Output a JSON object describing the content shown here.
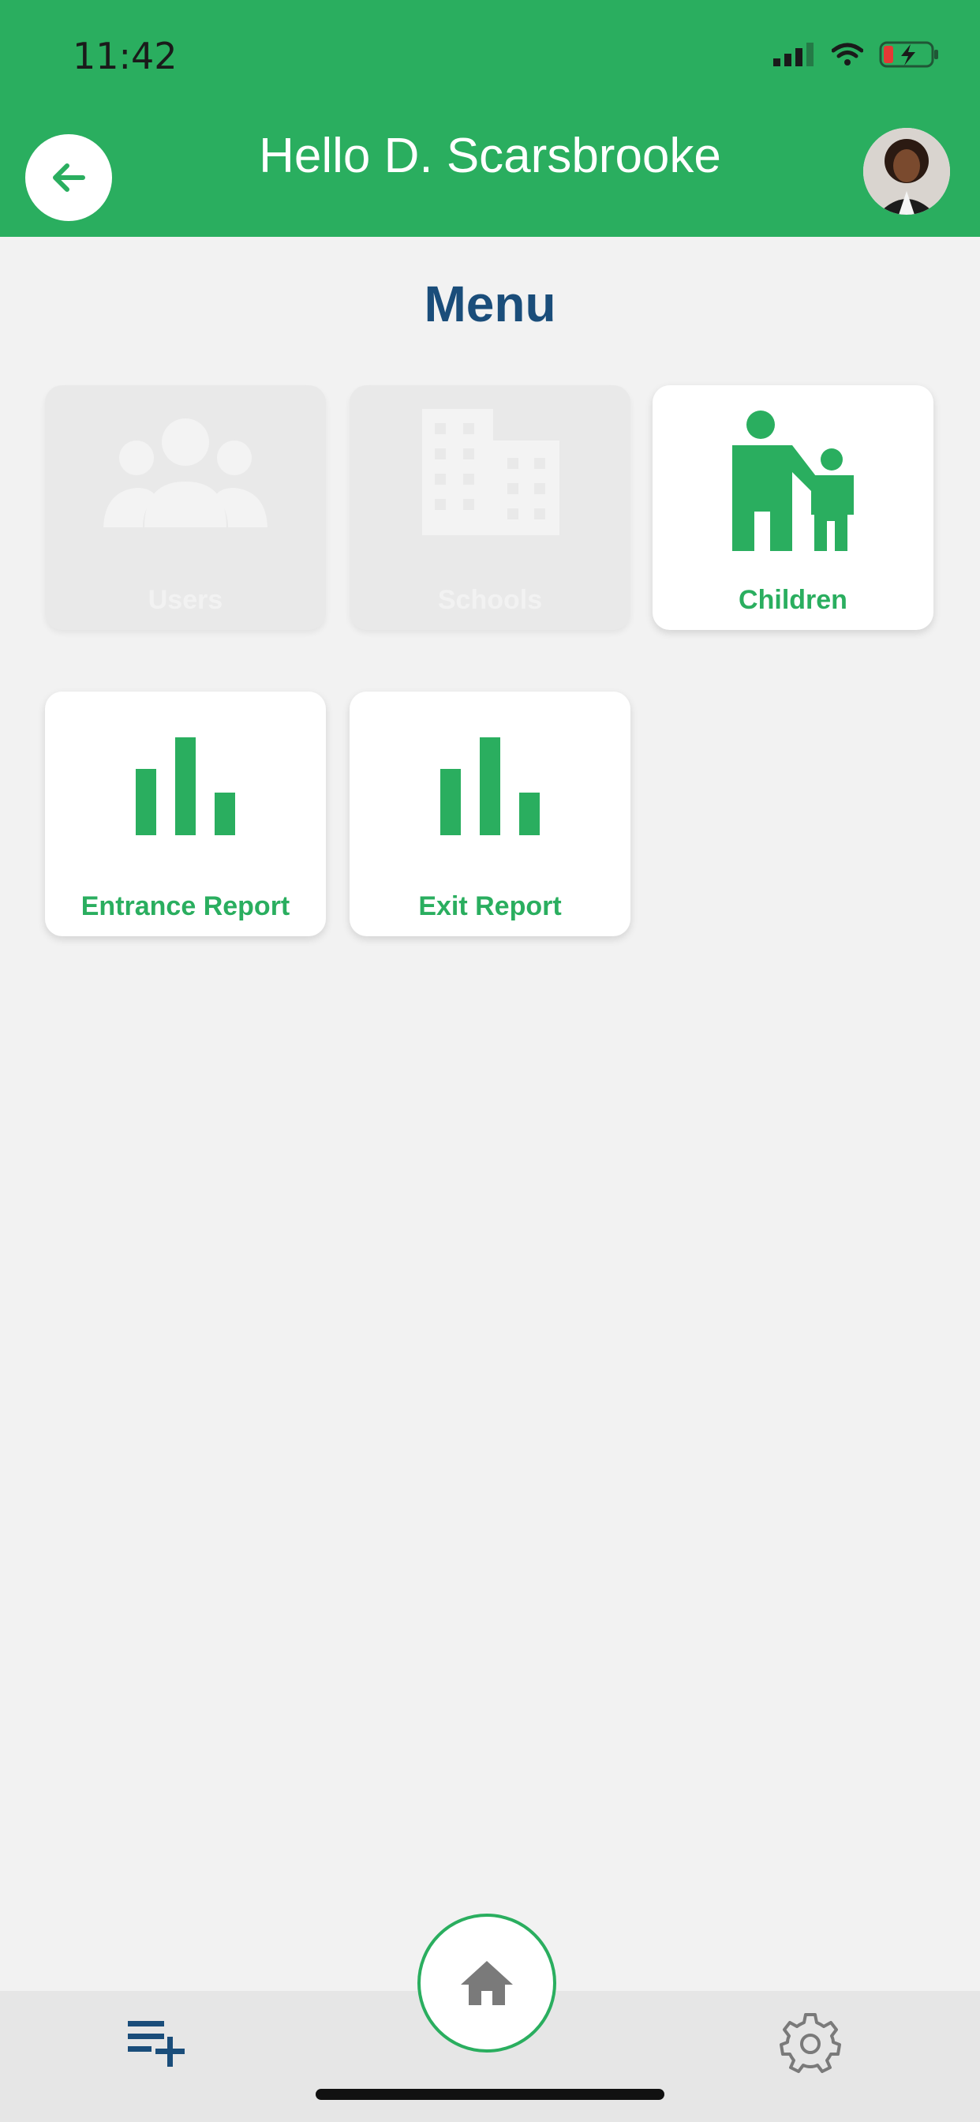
{
  "status_bar": {
    "time": "11:42"
  },
  "header": {
    "greeting": "Hello  D. Scarsbrooke"
  },
  "menu": {
    "title": "Menu",
    "tiles": [
      {
        "label": "Users",
        "icon": "users-icon",
        "enabled": false
      },
      {
        "label": "Schools",
        "icon": "building-icon",
        "enabled": false
      },
      {
        "label": "Children",
        "icon": "parent-child-icon",
        "enabled": true
      },
      {
        "label": "Entrance Report",
        "icon": "bar-chart-icon",
        "enabled": true
      },
      {
        "label": "Exit Report",
        "icon": "bar-chart-icon",
        "enabled": true
      }
    ]
  },
  "bottom_nav": {
    "left_icon": "playlist-add-icon",
    "center_icon": "home-icon",
    "right_icon": "settings-gear-icon"
  },
  "colors": {
    "accent": "#2aae5f",
    "title": "#1a4d7a",
    "background": "#f2f2f2",
    "disabled_tile": "#e9e9e9"
  }
}
